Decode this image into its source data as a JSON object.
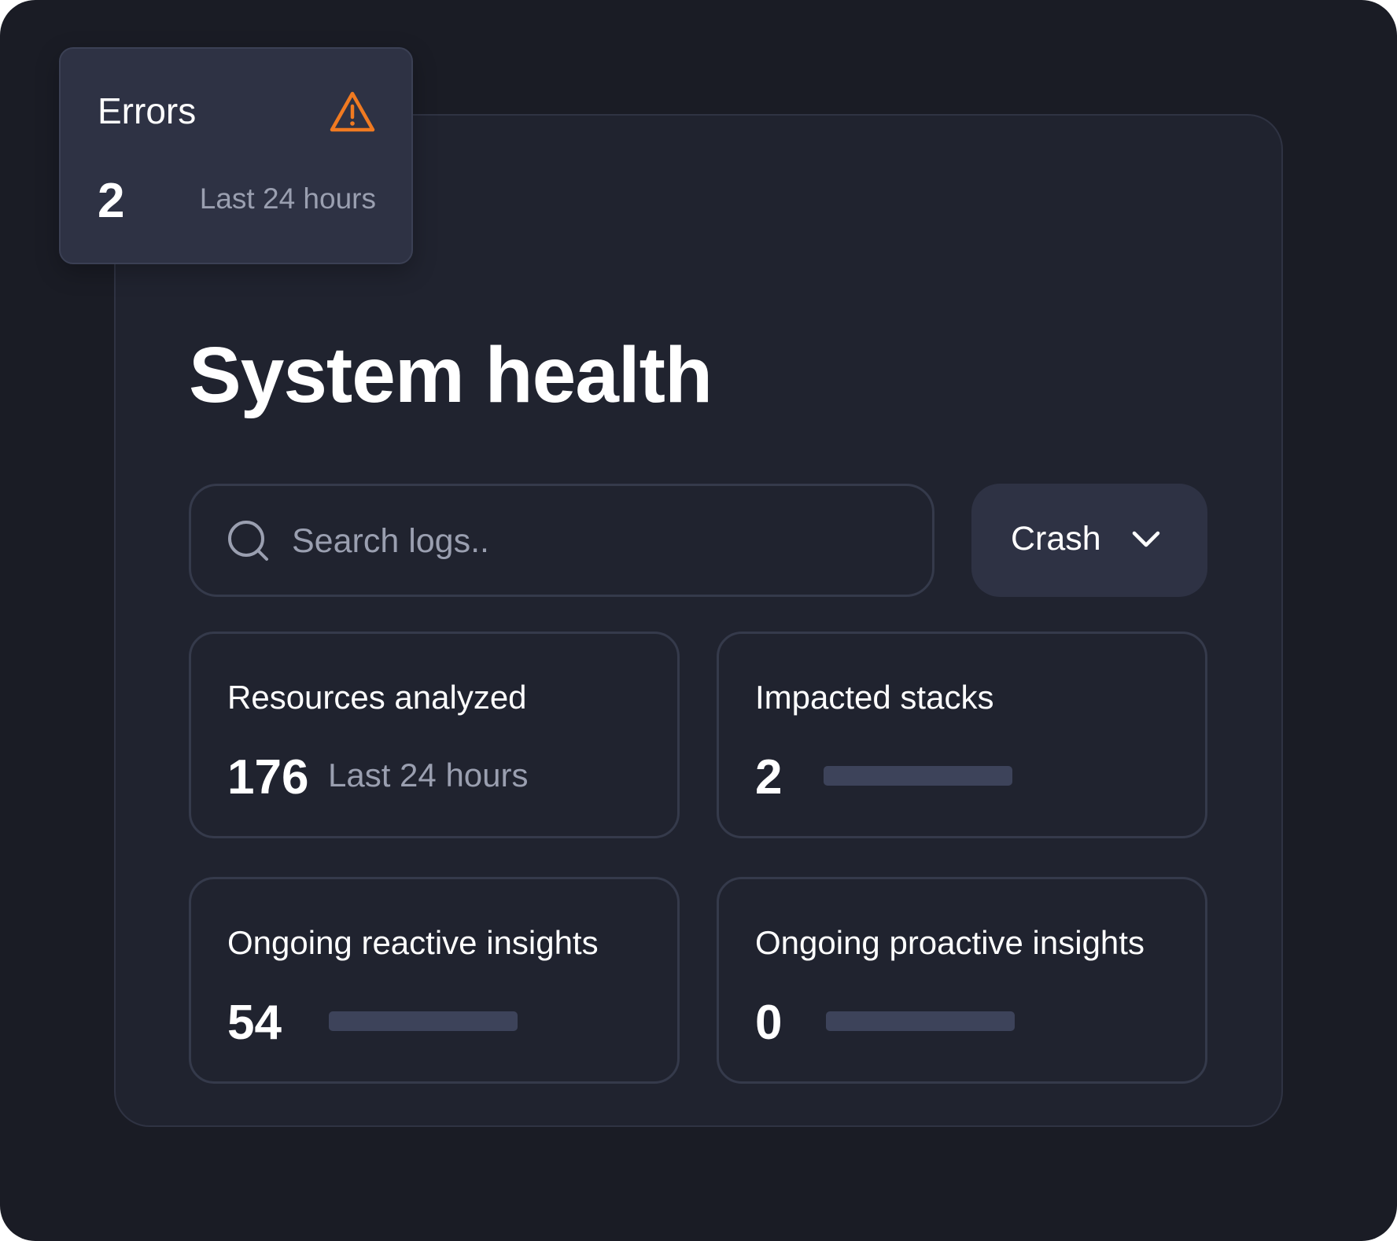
{
  "errors_card": {
    "title": "Errors",
    "count": "2",
    "period": "Last 24 hours",
    "icon": "warning-triangle-icon",
    "icon_color": "#f07a21"
  },
  "page": {
    "title": "System health"
  },
  "search": {
    "placeholder": "Search logs..",
    "value": "",
    "icon": "search-icon"
  },
  "filter": {
    "selected": "Crash",
    "icon": "chevron-down-icon"
  },
  "stats": {
    "resources": {
      "label": "Resources analyzed",
      "value": "176",
      "period": "Last 24 hours"
    },
    "impacted": {
      "label": "Impacted stacks",
      "value": "2"
    },
    "reactive": {
      "label": "Ongoing reactive insights",
      "value": "54"
    },
    "proactive": {
      "label": "Ongoing proactive insights",
      "value": "0"
    }
  },
  "colors": {
    "background": "#1a1c25",
    "card": "#20232f",
    "elevated_card": "#2e3244",
    "border": "#353a4b",
    "muted_text": "#9a9fb0",
    "bar": "#3d435a",
    "warning": "#f07a21"
  }
}
